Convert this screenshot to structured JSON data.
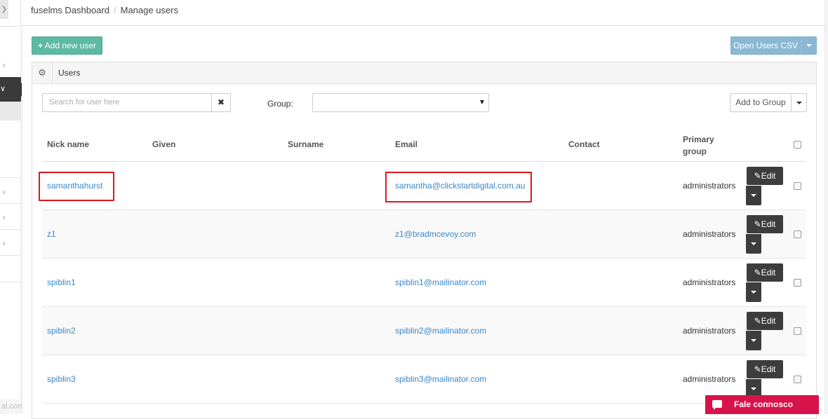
{
  "breadcrumb": {
    "home": "fuselms Dashboard",
    "separator": "/",
    "current": "Manage users"
  },
  "toolbar": {
    "add_user_label": "Add new user",
    "open_csv_label": "Open Users CSV"
  },
  "panel": {
    "title": "Users"
  },
  "filters": {
    "search_placeholder": "Search for user here",
    "clear_symbol": "✖",
    "group_label": "Group:",
    "group_value": "",
    "add_to_group_label": "Add to Group"
  },
  "table": {
    "headers": {
      "nick": "Nick name",
      "given": "Given",
      "surname": "Surname",
      "email": "Email",
      "contact": "Contact",
      "primary_group_1": "Primary",
      "primary_group_2": "group"
    },
    "edit_label": "Edit",
    "rows": [
      {
        "nick": "samanthahurst",
        "given": "",
        "surname": "",
        "email": "samantha@clickstartdigital.com.au",
        "contact": "",
        "group": "administrators"
      },
      {
        "nick": "z1",
        "given": "",
        "surname": "",
        "email": "z1@bradmcevoy.com",
        "contact": "",
        "group": "administrators"
      },
      {
        "nick": "spiblin1",
        "given": "",
        "surname": "",
        "email": "spiblin1@mailinator.com",
        "contact": "",
        "group": "administrators"
      },
      {
        "nick": "spiblin2",
        "given": "",
        "surname": "",
        "email": "spiblin2@mailinator.com",
        "contact": "",
        "group": "administrators"
      },
      {
        "nick": "spiblin3",
        "given": "",
        "surname": "",
        "email": "spiblin3@mailinator.com",
        "contact": "",
        "group": "administrators"
      }
    ]
  },
  "status_url": "al.com.au",
  "chat": {
    "label": "Fale connosco"
  },
  "colors": {
    "accent_green": "#5cb9a2",
    "csv_blue": "#8ab8d4",
    "link_blue": "#3c87c5",
    "edit_dark": "#3d3d3d",
    "highlight_red": "#e3141c",
    "chat_pink": "#d8124a"
  }
}
